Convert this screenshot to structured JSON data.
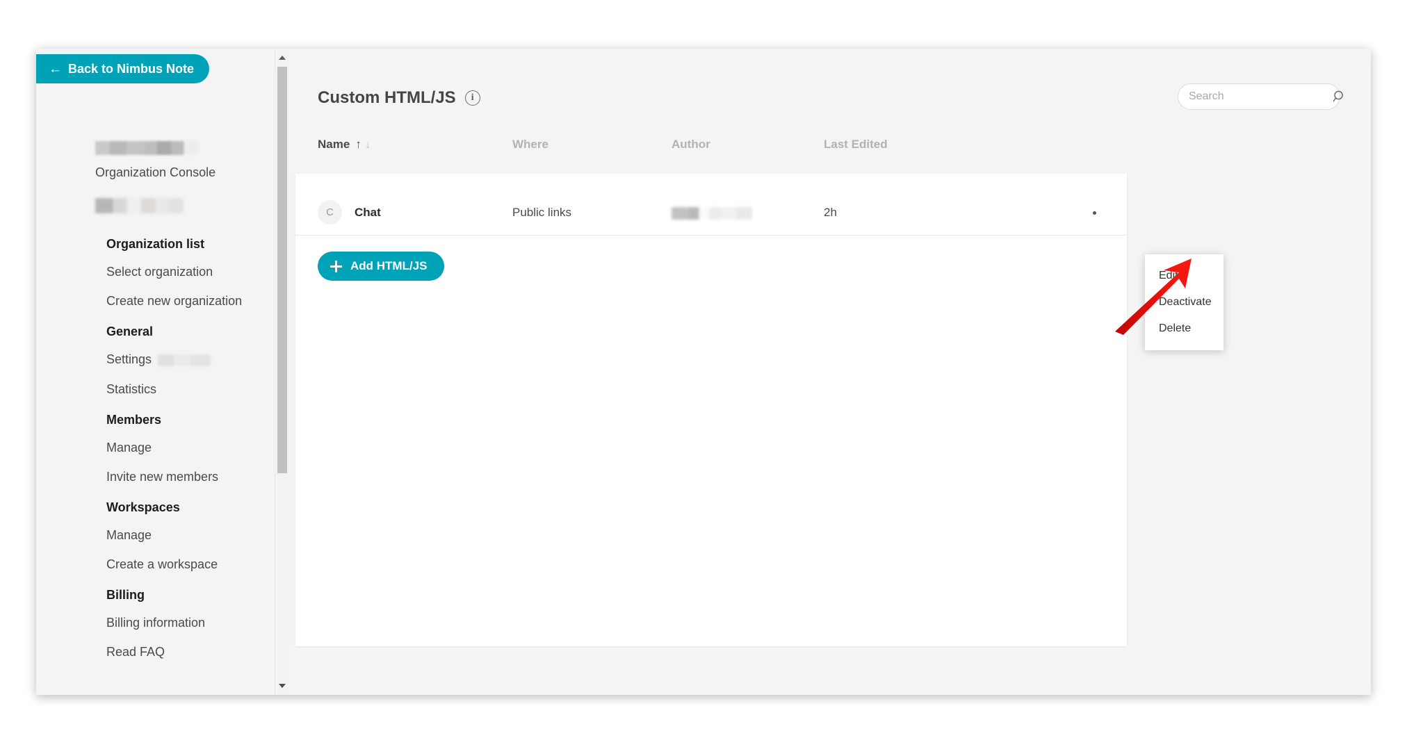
{
  "sidebar": {
    "back_button": {
      "label": "Back to Nimbus Note",
      "icon": "arrow-left-icon"
    },
    "org_console_label": "Organization Console",
    "groups": [
      {
        "heading": "Organization list",
        "items": [
          {
            "label": "Select organization"
          },
          {
            "label": "Create new organization"
          }
        ]
      },
      {
        "heading": "General",
        "items": [
          {
            "label": "Settings",
            "has_redaction": true
          },
          {
            "label": "Statistics"
          }
        ]
      },
      {
        "heading": "Members",
        "items": [
          {
            "label": "Manage"
          },
          {
            "label": "Invite new members"
          }
        ]
      },
      {
        "heading": "Workspaces",
        "items": [
          {
            "label": "Manage"
          },
          {
            "label": "Create a workspace"
          }
        ]
      },
      {
        "heading": "Billing",
        "items": [
          {
            "label": "Billing information"
          },
          {
            "label": "Read FAQ"
          }
        ]
      }
    ]
  },
  "main": {
    "page_title": "Custom HTML/JS",
    "info_icon": "info-icon",
    "search": {
      "placeholder": "Search",
      "value": "",
      "icon": "search-icon"
    },
    "table": {
      "columns": [
        {
          "key": "name",
          "label": "Name",
          "sorted": true,
          "sort_asc_icon": "↑",
          "sort_desc_icon": "↓"
        },
        {
          "key": "where",
          "label": "Where",
          "sorted": false
        },
        {
          "key": "author",
          "label": "Author",
          "sorted": false
        },
        {
          "key": "edited",
          "label": "Last Edited",
          "sorted": false
        }
      ],
      "rows": [
        {
          "avatar_initial": "C",
          "name": "Chat",
          "where": "Public links",
          "author_redacted": true,
          "last_edited": "2h",
          "menu_icon": "more-options-icon"
        }
      ]
    },
    "add_button": {
      "label": "Add HTML/JS",
      "icon": "plus-icon"
    }
  },
  "context_menu": {
    "items": [
      {
        "label": "Edit"
      },
      {
        "label": "Deactivate"
      },
      {
        "label": "Delete"
      }
    ]
  },
  "colors": {
    "accent": "#00a2b8",
    "annotation": "#e8120c",
    "page_bg": "#f4f4f4",
    "card_bg": "#ffffff"
  }
}
